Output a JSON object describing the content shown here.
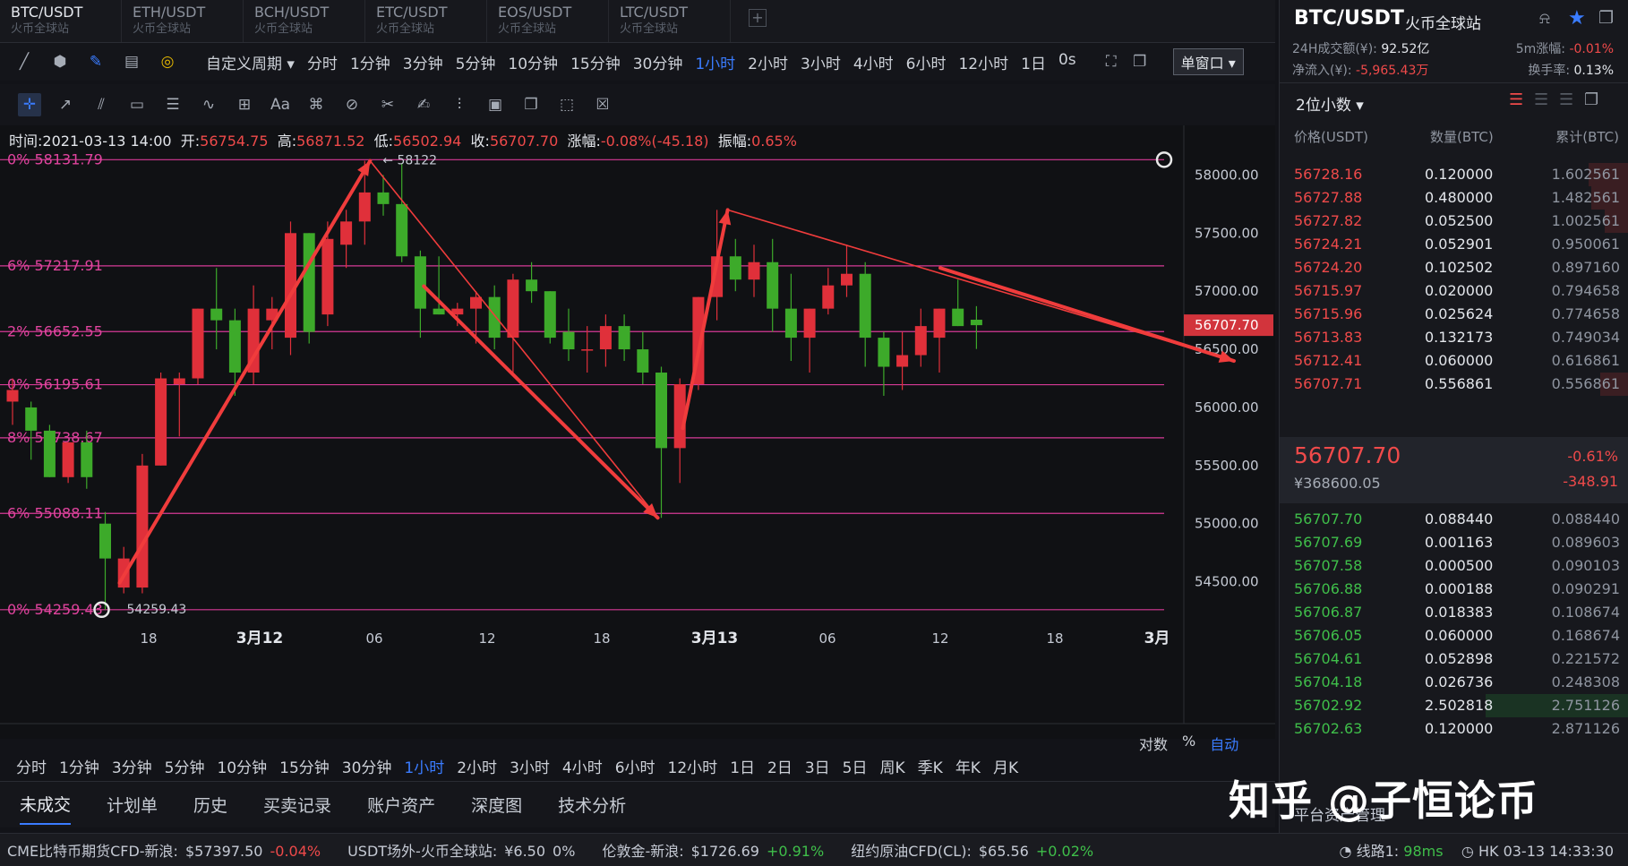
{
  "tabs": [
    {
      "pair": "BTC/USDT",
      "exchange": "火币全球站"
    },
    {
      "pair": "ETH/USDT",
      "exchange": "火币全球站"
    },
    {
      "pair": "BCH/USDT",
      "exchange": "火币全球站"
    },
    {
      "pair": "ETC/USDT",
      "exchange": "火币全球站"
    },
    {
      "pair": "EOS/USDT",
      "exchange": "火币全球站"
    },
    {
      "pair": "LTC/USDT",
      "exchange": "火币全球站"
    }
  ],
  "tab_add": "+",
  "toolbar": {
    "custom_period": "自定义周期",
    "periods": [
      "分时",
      "1分钟",
      "3分钟",
      "5分钟",
      "10分钟",
      "15分钟",
      "30分钟",
      "1小时",
      "2小时",
      "3小时",
      "4小时",
      "6小时",
      "12小时",
      "1日",
      "0s"
    ],
    "active_period": "1小时",
    "window_mode": "单窗口",
    "text_tool": "Aa"
  },
  "info": {
    "time_label": "时间:",
    "time": "2021-03-13 14:00",
    "open_label": "开:",
    "open": "56754.75",
    "high_label": "高:",
    "high": "56871.52",
    "low_label": "低:",
    "low": "56502.94",
    "close_label": "收:",
    "close": "56707.70",
    "change_label": "涨幅:",
    "change": "-0.08%(-45.18)",
    "amp_label": "振幅:",
    "amp": "0.65%"
  },
  "chart_data": {
    "type": "candlestick",
    "interval": "1小时",
    "ylim": [
      54150,
      58350
    ],
    "y_ticks": [
      54500,
      55000,
      55500,
      56000,
      56500,
      57000,
      57500,
      58000
    ],
    "y_tick_labels": [
      "54500.00",
      "55000.00",
      "55500.00",
      "56000.00",
      "56500.00",
      "57000.00",
      "57500.00",
      "58000.00"
    ],
    "x_labels": [
      "18",
      "3月12",
      "06",
      "12",
      "18",
      "3月13",
      "06",
      "12",
      "18",
      "3月"
    ],
    "current_price": "56707.70",
    "fib_levels": [
      {
        "label": "0% 58131.79",
        "value": 58131.79
      },
      {
        "label": "6% 57217.91",
        "value": 57217.91
      },
      {
        "label": "2% 56652.55",
        "value": 56652.55
      },
      {
        "label": "0% 56195.61",
        "value": 56195.61
      },
      {
        "label": "8% 55738.67",
        "value": 55738.67
      },
      {
        "label": "6% 55088.11",
        "value": 55088.11
      },
      {
        "label": "0% 54259.43",
        "value": 54259.43
      }
    ],
    "annotations": [
      {
        "text": "← 58122",
        "value": 58122
      },
      {
        "text": "54259.43",
        "value": 54259.43
      }
    ],
    "candles": [
      {
        "o": 56050,
        "h": 56250,
        "l": 55850,
        "c": 56150
      },
      {
        "o": 56000,
        "h": 56050,
        "l": 55550,
        "c": 55800
      },
      {
        "o": 55800,
        "h": 55850,
        "l": 55400,
        "c": 55400
      },
      {
        "o": 55400,
        "h": 55700,
        "l": 55350,
        "c": 55700
      },
      {
        "o": 55700,
        "h": 55800,
        "l": 55300,
        "c": 55400
      },
      {
        "o": 55000,
        "h": 55100,
        "l": 54259,
        "c": 54700
      },
      {
        "o": 54450,
        "h": 54800,
        "l": 54400,
        "c": 54700
      },
      {
        "o": 54450,
        "h": 55600,
        "l": 54400,
        "c": 55500
      },
      {
        "o": 55500,
        "h": 56300,
        "l": 55500,
        "c": 56250
      },
      {
        "o": 56200,
        "h": 56300,
        "l": 55750,
        "c": 56250
      },
      {
        "o": 56250,
        "h": 56850,
        "l": 56200,
        "c": 56850
      },
      {
        "o": 56850,
        "h": 57200,
        "l": 56500,
        "c": 56750
      },
      {
        "o": 56750,
        "h": 56850,
        "l": 56100,
        "c": 56300
      },
      {
        "o": 56300,
        "h": 57050,
        "l": 56200,
        "c": 56850
      },
      {
        "o": 56750,
        "h": 56950,
        "l": 56500,
        "c": 56850
      },
      {
        "o": 56600,
        "h": 57600,
        "l": 56450,
        "c": 57500
      },
      {
        "o": 57500,
        "h": 57500,
        "l": 56550,
        "c": 56650
      },
      {
        "o": 56800,
        "h": 57600,
        "l": 56700,
        "c": 57450
      },
      {
        "o": 57400,
        "h": 57700,
        "l": 57200,
        "c": 57600
      },
      {
        "o": 57600,
        "h": 58122,
        "l": 57400,
        "c": 57850
      },
      {
        "o": 57850,
        "h": 58000,
        "l": 57650,
        "c": 57750
      },
      {
        "o": 57750,
        "h": 58100,
        "l": 57250,
        "c": 57300
      },
      {
        "o": 57300,
        "h": 57350,
        "l": 56600,
        "c": 56850
      },
      {
        "o": 56850,
        "h": 57300,
        "l": 56800,
        "c": 56800
      },
      {
        "o": 56800,
        "h": 56900,
        "l": 56700,
        "c": 56850
      },
      {
        "o": 56850,
        "h": 57000,
        "l": 56550,
        "c": 56950
      },
      {
        "o": 56950,
        "h": 57050,
        "l": 56500,
        "c": 56600
      },
      {
        "o": 56600,
        "h": 57150,
        "l": 56300,
        "c": 57100
      },
      {
        "o": 57100,
        "h": 57250,
        "l": 56900,
        "c": 57000
      },
      {
        "o": 57000,
        "h": 57000,
        "l": 56550,
        "c": 56600
      },
      {
        "o": 56650,
        "h": 56850,
        "l": 56400,
        "c": 56500
      },
      {
        "o": 56500,
        "h": 56700,
        "l": 56300,
        "c": 56500
      },
      {
        "o": 56500,
        "h": 56800,
        "l": 56350,
        "c": 56700
      },
      {
        "o": 56700,
        "h": 56800,
        "l": 56400,
        "c": 56500
      },
      {
        "o": 56500,
        "h": 56650,
        "l": 56200,
        "c": 56300
      },
      {
        "o": 56300,
        "h": 56350,
        "l": 55050,
        "c": 55650
      },
      {
        "o": 55650,
        "h": 56250,
        "l": 55350,
        "c": 56200
      },
      {
        "o": 56200,
        "h": 56950,
        "l": 56150,
        "c": 56950
      },
      {
        "o": 56950,
        "h": 57700,
        "l": 56750,
        "c": 57300
      },
      {
        "o": 57300,
        "h": 57450,
        "l": 57000,
        "c": 57100
      },
      {
        "o": 57100,
        "h": 57400,
        "l": 56950,
        "c": 57250
      },
      {
        "o": 57250,
        "h": 57450,
        "l": 56650,
        "c": 56850
      },
      {
        "o": 56850,
        "h": 57150,
        "l": 56400,
        "c": 56600
      },
      {
        "o": 56600,
        "h": 56850,
        "l": 56300,
        "c": 56850
      },
      {
        "o": 56850,
        "h": 57200,
        "l": 56800,
        "c": 57050
      },
      {
        "o": 57050,
        "h": 57400,
        "l": 56950,
        "c": 57150
      },
      {
        "o": 57150,
        "h": 57250,
        "l": 56350,
        "c": 56600
      },
      {
        "o": 56600,
        "h": 56650,
        "l": 56100,
        "c": 56350
      },
      {
        "o": 56350,
        "h": 56650,
        "l": 56150,
        "c": 56450
      },
      {
        "o": 56450,
        "h": 56850,
        "l": 56350,
        "c": 56700
      },
      {
        "o": 56600,
        "h": 56850,
        "l": 56300,
        "c": 56850
      },
      {
        "o": 56850,
        "h": 57100,
        "l": 56700,
        "c": 56700
      },
      {
        "o": 56754.75,
        "h": 56871.52,
        "l": 56502.94,
        "c": 56707.7
      }
    ]
  },
  "bottom_periods": [
    "分时",
    "1分钟",
    "3分钟",
    "5分钟",
    "10分钟",
    "15分钟",
    "30分钟",
    "1小时",
    "2小时",
    "3小时",
    "4小时",
    "6小时",
    "12小时",
    "1日",
    "2日",
    "3日",
    "5日",
    "周K",
    "季K",
    "年K",
    "月K"
  ],
  "scale_options": [
    "对数",
    "%",
    "自动"
  ],
  "bottom_tabs": [
    "未成交",
    "计划单",
    "历史",
    "买卖记录",
    "账户资产",
    "深度图",
    "技术分析"
  ],
  "ticker": [
    {
      "name": "CME比特币期货CFD-新浪:",
      "price": "$57397.50",
      "change": "-0.04%",
      "dir": "down"
    },
    {
      "name": "USDT场外-火币全球站:",
      "price": "¥6.50",
      "change": "0%",
      "dir": "flat"
    },
    {
      "name": "伦敦金-新浪:",
      "price": "$1726.69",
      "change": "+0.91%",
      "dir": "up"
    },
    {
      "name": "纽约原油CFD(CL):",
      "price": "$65.56",
      "change": "+0.02%",
      "dir": "up"
    }
  ],
  "status": {
    "network": "线路1:",
    "latency": "98ms",
    "clock": "HK 03-13 14:33:30"
  },
  "panel": {
    "pair": "BTC/USDT",
    "exchange": "火币全球站",
    "vol_label": "24H成交额(¥):",
    "vol": "92.52亿",
    "chg5_label": "5m涨幅:",
    "chg5": "-0.01%",
    "flow_label": "净流入(¥):",
    "flow": "-5,965.43万",
    "turn_label": "换手率:",
    "turn": "0.13%",
    "decimals": "2位小数",
    "col_price": "价格(USDT)",
    "col_qty": "数量(BTC)",
    "col_cum": "累计(BTC)",
    "last": "56707.70",
    "last_cny": "¥368600.05",
    "last_pct": "-0.61%",
    "last_chg": "-348.91",
    "asks": [
      {
        "p": "56728.16",
        "q": "0.120000",
        "c": "1.602561",
        "w": 0.28
      },
      {
        "p": "56727.88",
        "q": "0.480000",
        "c": "1.482561",
        "w": 0.26
      },
      {
        "p": "56727.82",
        "q": "0.052500",
        "c": "1.002561",
        "w": 0.17
      },
      {
        "p": "56724.21",
        "q": "0.052901",
        "c": "0.950061",
        "w": 0.0
      },
      {
        "p": "56724.20",
        "q": "0.102502",
        "c": "0.897160",
        "w": 0.0
      },
      {
        "p": "56715.97",
        "q": "0.020000",
        "c": "0.794658",
        "w": 0.0
      },
      {
        "p": "56715.96",
        "q": "0.025624",
        "c": "0.774658",
        "w": 0.0
      },
      {
        "p": "56713.83",
        "q": "0.132173",
        "c": "0.749034",
        "w": 0.0
      },
      {
        "p": "56712.41",
        "q": "0.060000",
        "c": "0.616861",
        "w": 0.0
      },
      {
        "p": "56707.71",
        "q": "0.556861",
        "c": "0.556861",
        "w": 0.2
      }
    ],
    "bids": [
      {
        "p": "56707.70",
        "q": "0.088440",
        "c": "0.088440",
        "w": 0.0
      },
      {
        "p": "56707.69",
        "q": "0.001163",
        "c": "0.089603",
        "w": 0.0
      },
      {
        "p": "56707.58",
        "q": "0.000500",
        "c": "0.090103",
        "w": 0.0
      },
      {
        "p": "56706.88",
        "q": "0.000188",
        "c": "0.090291",
        "w": 0.0
      },
      {
        "p": "56706.87",
        "q": "0.018383",
        "c": "0.108674",
        "w": 0.0
      },
      {
        "p": "56706.05",
        "q": "0.060000",
        "c": "0.168674",
        "w": 0.0
      },
      {
        "p": "56704.61",
        "q": "0.052898",
        "c": "0.221572",
        "w": 0.0
      },
      {
        "p": "56704.18",
        "q": "0.026736",
        "c": "0.248308",
        "w": 0.0
      },
      {
        "p": "56702.92",
        "q": "2.502818",
        "c": "2.751126",
        "w": 1.0
      },
      {
        "p": "56702.63",
        "q": "0.120000",
        "c": "2.871126",
        "w": 0.0
      }
    ],
    "footer": "平台资产管理"
  },
  "watermark": "知乎 @子恒论币",
  "colors": {
    "up": "#e0303a",
    "down": "#3daa2a",
    "fib": "#d63a96",
    "draw": "#f03c3c",
    "accent": "#3a7cff"
  }
}
